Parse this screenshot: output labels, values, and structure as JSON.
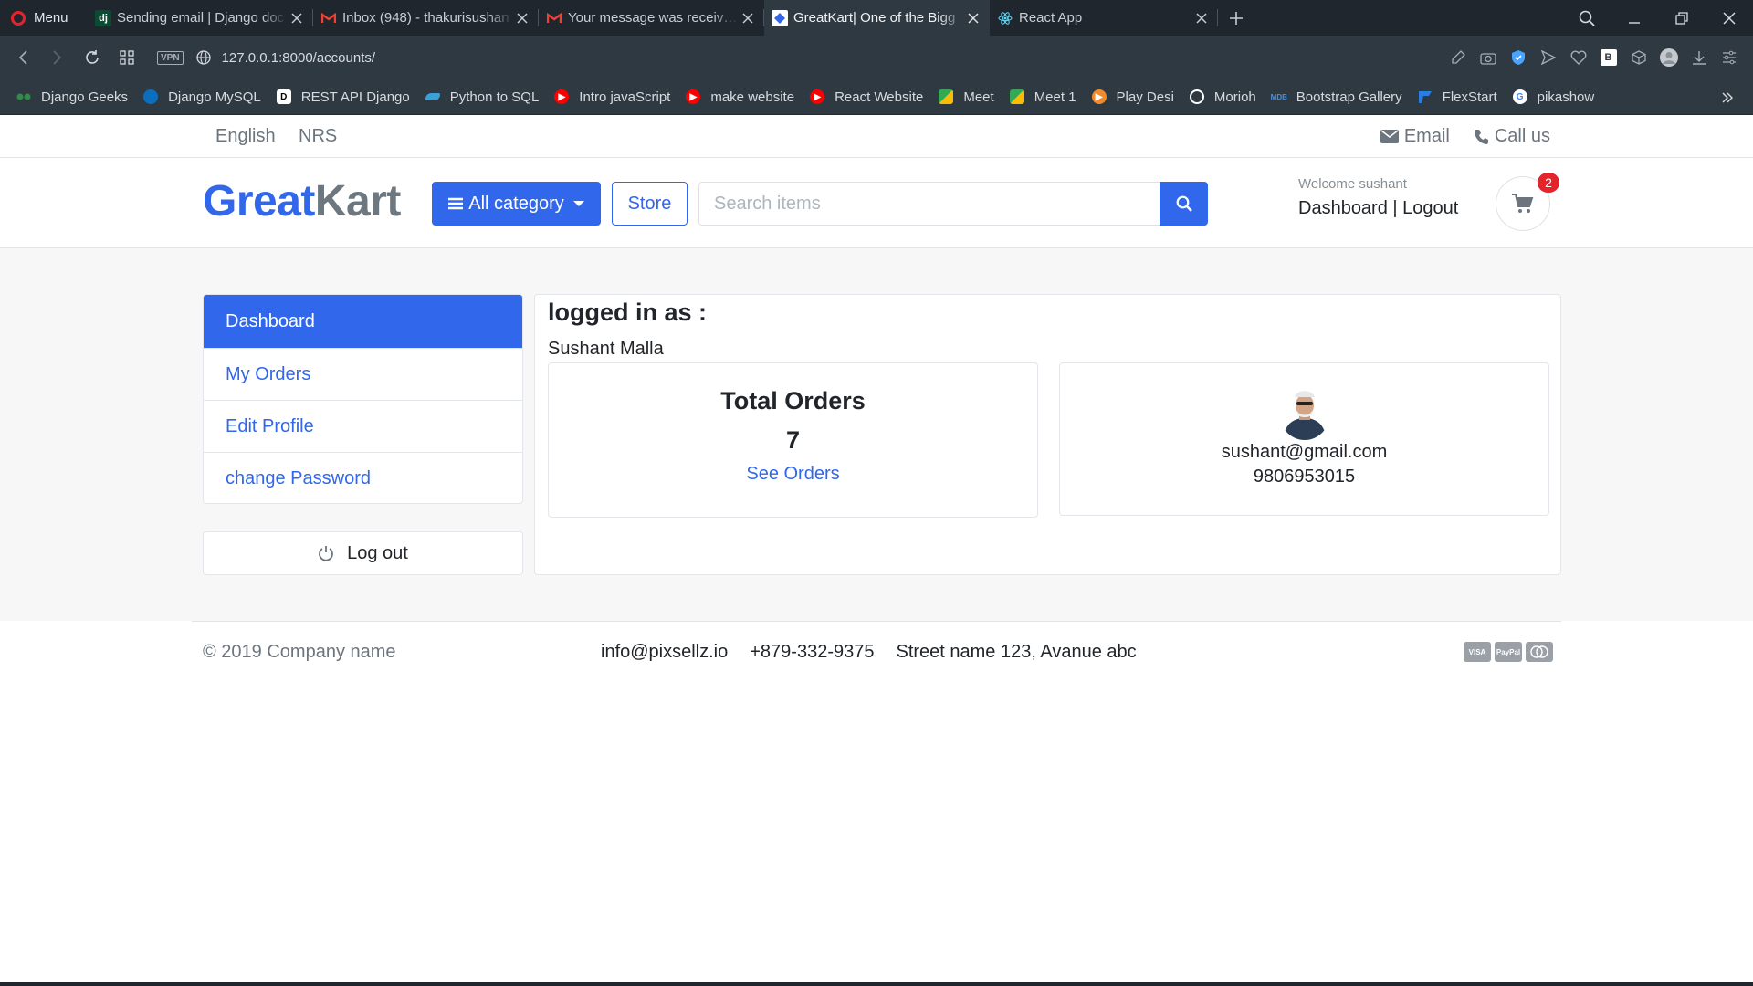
{
  "browser": {
    "menu_label": "Menu",
    "tabs": [
      {
        "title": "Sending email | Django doc",
        "favicon": "django-icon"
      },
      {
        "title": "Inbox (948) - thakurisushan",
        "favicon": "gmail-icon"
      },
      {
        "title": "Your message was received",
        "favicon": "gmail-icon"
      },
      {
        "title": "GreatKart| One of the Bigg",
        "favicon": "greatkart-icon",
        "active": true
      },
      {
        "title": "React App",
        "favicon": "react-icon"
      }
    ],
    "url": "127.0.0.1:8000/accounts/",
    "vpn_label": "VPN",
    "bookmarks": [
      {
        "label": "Django Geeks"
      },
      {
        "label": "Django MySQL"
      },
      {
        "label": "REST API Django"
      },
      {
        "label": "Python to SQL"
      },
      {
        "label": "Intro javaScript"
      },
      {
        "label": "make website"
      },
      {
        "label": "React Website"
      },
      {
        "label": "Meet"
      },
      {
        "label": "Meet 1"
      },
      {
        "label": "Play Desi"
      },
      {
        "label": "Morioh"
      },
      {
        "label": "Bootstrap Gallery"
      },
      {
        "label": "FlexStart"
      },
      {
        "label": "pikashow"
      }
    ]
  },
  "topbar": {
    "language": "English",
    "currency": "NRS",
    "email_label": "Email",
    "call_label": "Call us"
  },
  "header": {
    "logo_part1": "Great",
    "logo_part2": "Kart",
    "category_label": "All category",
    "store_label": "Store",
    "search_placeholder": "Search items",
    "welcome": "Welcome sushant",
    "dashboard_link": "Dashboard",
    "separator": "|",
    "logout_link": "Logout",
    "cart_count": "2"
  },
  "sidebar": {
    "items": [
      {
        "label": "Dashboard"
      },
      {
        "label": "My Orders"
      },
      {
        "label": "Edit Profile"
      },
      {
        "label": "change Password"
      }
    ],
    "logout_label": "Log out"
  },
  "dashboard": {
    "heading": "logged in as :",
    "user_name": "Sushant Malla",
    "total_orders_label": "Total Orders",
    "total_orders_value": "7",
    "see_orders_label": "See Orders",
    "email": "sushant@gmail.com",
    "phone": "9806953015"
  },
  "footer": {
    "copyright": "© 2019 Company name",
    "email": "info@pixsellz.io",
    "phone": "+879-332-9375",
    "address": "Street name 123, Avanue abc",
    "payments": [
      "VISA",
      "PayPal",
      "MC"
    ]
  },
  "colors": {
    "brand": "#3167eb",
    "badge": "#e3242b"
  }
}
